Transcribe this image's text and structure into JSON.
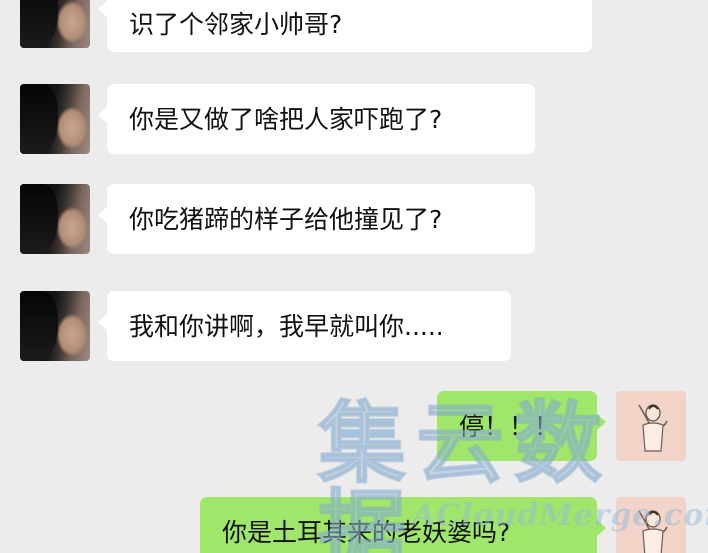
{
  "messages": [
    {
      "side": "incoming",
      "avatar": "contact-avatar",
      "text": "识了个邻家小帅哥?"
    },
    {
      "side": "incoming",
      "avatar": "contact-avatar",
      "text": "你是又做了啥把人家吓跑了?"
    },
    {
      "side": "incoming",
      "avatar": "contact-avatar",
      "text": "你吃猪蹄的样子给他撞见了?"
    },
    {
      "side": "incoming",
      "avatar": "contact-avatar",
      "text": "我和你讲啊，我早就叫你....."
    },
    {
      "side": "outgoing",
      "avatar": "self-avatar",
      "text": "停！！！"
    },
    {
      "side": "outgoing",
      "avatar": "self-avatar",
      "text": "你是土耳其来的老妖婆吗?"
    }
  ],
  "watermark": {
    "chinese": "集云数据",
    "english": "ACloudMerge.com"
  },
  "colors": {
    "background": "#ececec",
    "incoming_bubble": "#ffffff",
    "outgoing_bubble": "#9fe66a",
    "text": "#111111"
  }
}
